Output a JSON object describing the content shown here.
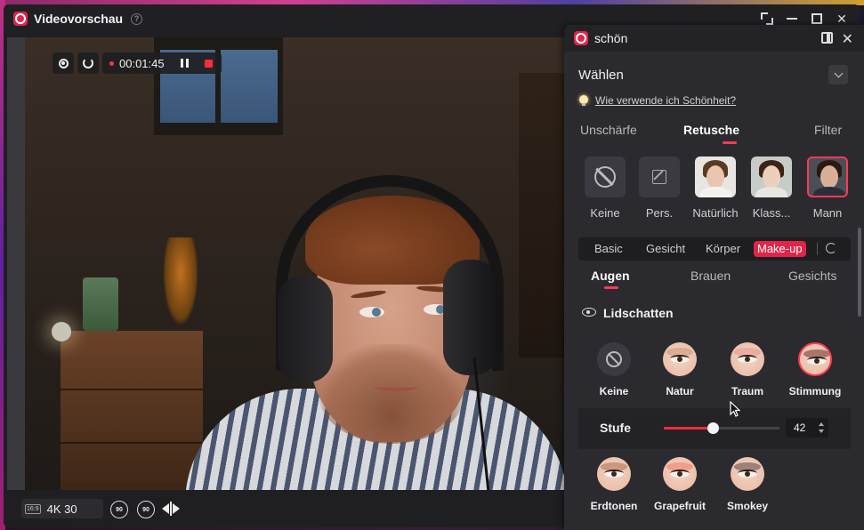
{
  "window": {
    "title": "Videovorschau",
    "help_glyph": "?"
  },
  "video": {
    "record_time": "00:01:45"
  },
  "bottom_bar": {
    "ratio": "16:9",
    "resolution": "4K 30",
    "rewind_label": "90",
    "forward_label": "90"
  },
  "panel": {
    "title": "schön",
    "choose_label": "Wählen",
    "help_link": "Wie verwende ich Schönheit?",
    "main_tabs": [
      "Unschärfe",
      "Retusche",
      "Filter"
    ],
    "active_main_tab": "Retusche",
    "presets": [
      "Keine",
      "Pers.",
      "Natürlich",
      "Klass...",
      "Mann"
    ],
    "selected_preset": "Mann",
    "sub_tabs": [
      "Basic",
      "Gesicht",
      "Körper",
      "Make-up"
    ],
    "active_sub_tab": "Make-up",
    "makeup_tabs": [
      "Augen",
      "Brauen",
      "Gesichts"
    ],
    "active_makeup_tab": "Augen",
    "section_title": "Lidschatten",
    "shadows_row1": [
      "Keine",
      "Natur",
      "Traum",
      "Stimmung"
    ],
    "selected_shadow": "Stimmung",
    "level_label": "Stufe",
    "level_value": "42",
    "level_fraction": 0.42,
    "shadows_row2": [
      "Erdtonen",
      "Grapefruit",
      "Smokey"
    ]
  },
  "colors": {
    "accent": "#e0254a",
    "panel_bg": "#2b2b2f",
    "window_bg": "#1f1f22"
  }
}
